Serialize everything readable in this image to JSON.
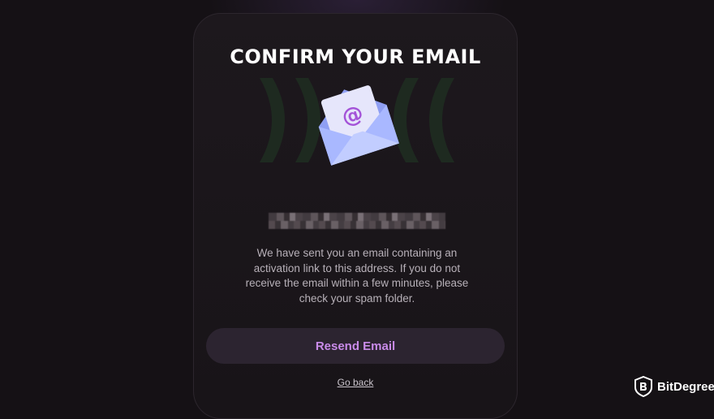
{
  "card": {
    "title": "CONFIRM YOUR EMAIL",
    "email_icon": "envelope-at-icon",
    "description": "We have sent you an email containing an activation link to this address. If you do not receive the email within a few minutes, please check your spam folder.",
    "resend_label": "Resend Email",
    "go_back_label": "Go back"
  },
  "watermark": {
    "brand_name": "BitDegree",
    "icon": "bitdegree-shield-icon"
  },
  "colors": {
    "background": "#141013",
    "card": "#1b161b",
    "accent": "#c98be9",
    "button_bg": "#2c2430",
    "envelope": "#a9b8ff"
  }
}
